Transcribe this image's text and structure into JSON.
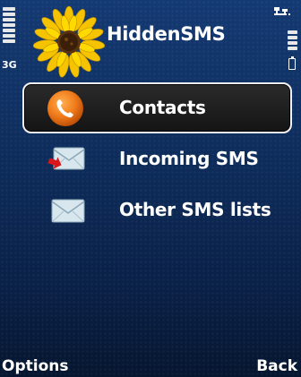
{
  "status_bar": {
    "network_type": "3G",
    "signal_icon": "signal-strength-icon",
    "battery_icon": "battery-icon",
    "connection_icon": "data-connection-icon"
  },
  "header": {
    "title": "HiddenSMS",
    "logo_icon": "sunflower-icon"
  },
  "menu": {
    "items": [
      {
        "label": "Contacts",
        "icon": "phone-handset-icon",
        "selected": true
      },
      {
        "label": "Incoming SMS",
        "icon": "envelope-incoming-icon",
        "selected": false
      },
      {
        "label": "Other SMS lists",
        "icon": "envelope-icon",
        "selected": false
      }
    ]
  },
  "softkeys": {
    "left": "Options",
    "right": "Back"
  },
  "colors": {
    "background": "#0e2d5c",
    "selection_border": "#f2f2f2",
    "selection_fill": "#1e1e1e",
    "contacts_icon": "#f07a1a"
  }
}
